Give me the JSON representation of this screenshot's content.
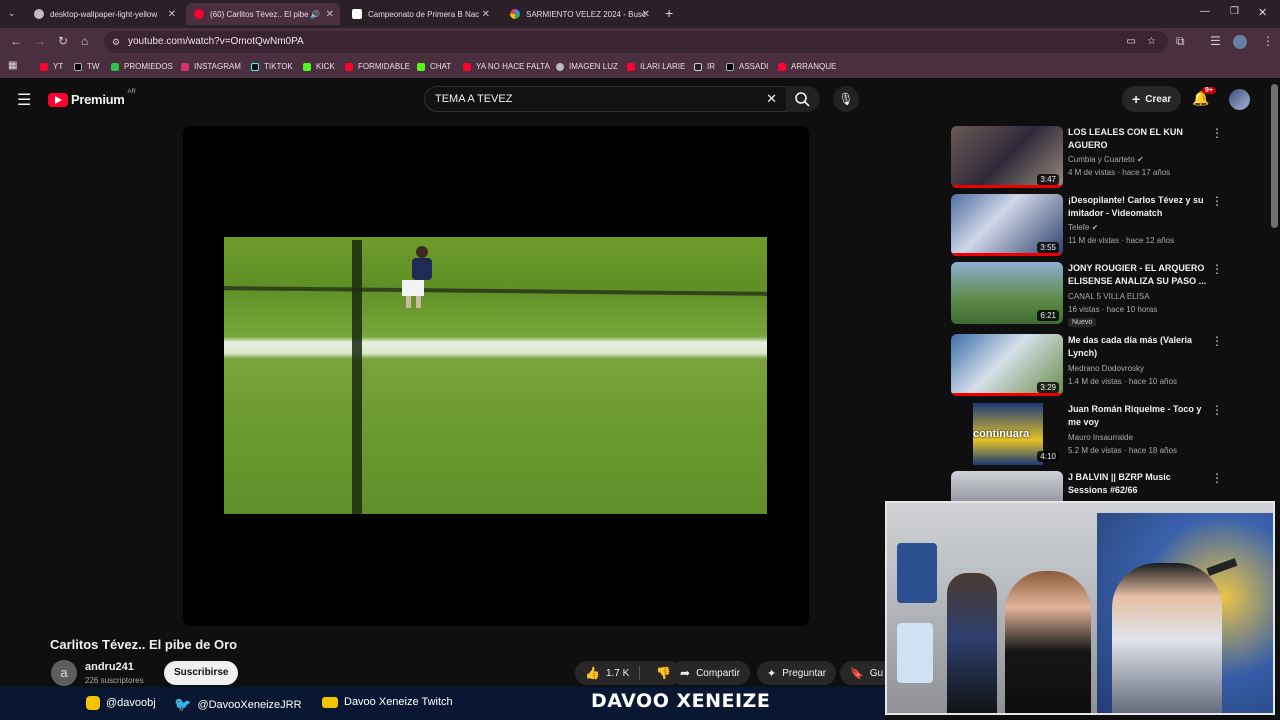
{
  "browser": {
    "tabs": [
      {
        "title": "desktop-wallpaper-light-yellow"
      },
      {
        "title": "(60) Carlitos Tévez.. El pibe"
      },
      {
        "title": "Campeonato de Primera B Nac"
      },
      {
        "title": "SARMIENTO VELEZ 2024 - Busc"
      }
    ],
    "url": "youtube.com/watch?v=OmotQwNm0PA",
    "bookmarks": [
      "YT",
      "TW",
      "PROMIEDOS",
      "INSTAGRAM",
      "TIKTOK",
      "KICK",
      "FORMIDABLE",
      "CHAT",
      "YA NO HACE FALTA",
      "IMAGEN LUZ",
      "ILARI LARIE",
      "IR",
      "ASSADI",
      "ARRANQUE"
    ]
  },
  "youtube": {
    "logo": "Premium",
    "region": "AR",
    "search_value": "TEMA A TEVEZ",
    "create_label": "Crear",
    "notif_badge": "9+"
  },
  "video": {
    "title": "Carlitos Tévez.. El pibe de Oro",
    "channel": "andru241",
    "avatar_letter": "a",
    "subscribers": "226 suscriptores",
    "subscribe_label": "Suscribirse",
    "likes": "1.7 K",
    "share_label": "Compartir",
    "ask_label": "Preguntar",
    "save_label": "Gu"
  },
  "recommendations": [
    {
      "title": "LOS LEALES CON EL KUN AGUERO",
      "channel": "Cumbia y Cuarteto",
      "verified": true,
      "meta": "4 M de vistas · hace 17 años",
      "duration": "3:47"
    },
    {
      "title": "¡Desopilante! Carlos Tévez y su imitador - Videomatch",
      "channel": "Telefe",
      "verified": true,
      "meta": "11 M de vistas · hace 12 años",
      "duration": "3:55"
    },
    {
      "title": "JONY ROUGIER - EL ARQUERO ELISENSE ANALIZA SU PASO ...",
      "channel": "CANAL 5 VILLA ELISA",
      "verified": false,
      "meta": "16 vistas · hace 10 horas",
      "duration": "6:21",
      "badge": "Nuevo"
    },
    {
      "title": "Me das cada día más (Valeria Lynch)",
      "channel": "Medrano Dodovrosky",
      "verified": false,
      "meta": "1.4 M de vistas · hace 10 años",
      "duration": "3:29"
    },
    {
      "title": "Juan Román Riquelme - Toco y me voy",
      "channel": "Mauro Insaurralde",
      "verified": false,
      "meta": "5.2 M de vistas · hace 18 años",
      "duration": "4:10",
      "thumb_text": "continuara"
    },
    {
      "title": "J BALVIN || BZRP Music Sessions #62/66",
      "channel": "",
      "verified": false,
      "meta": "",
      "duration": ""
    }
  ],
  "stream": {
    "instagram": "@davoobj",
    "twitter": "@DavooXeneizeJRR",
    "twitch": "Davoo Xeneize Twitch",
    "brand": "DAVOO XENEIZE"
  },
  "colors": {
    "accent_red": "#ff0033",
    "browser_frame": "#4a2f3f",
    "stream_bar": "#0a1733"
  }
}
